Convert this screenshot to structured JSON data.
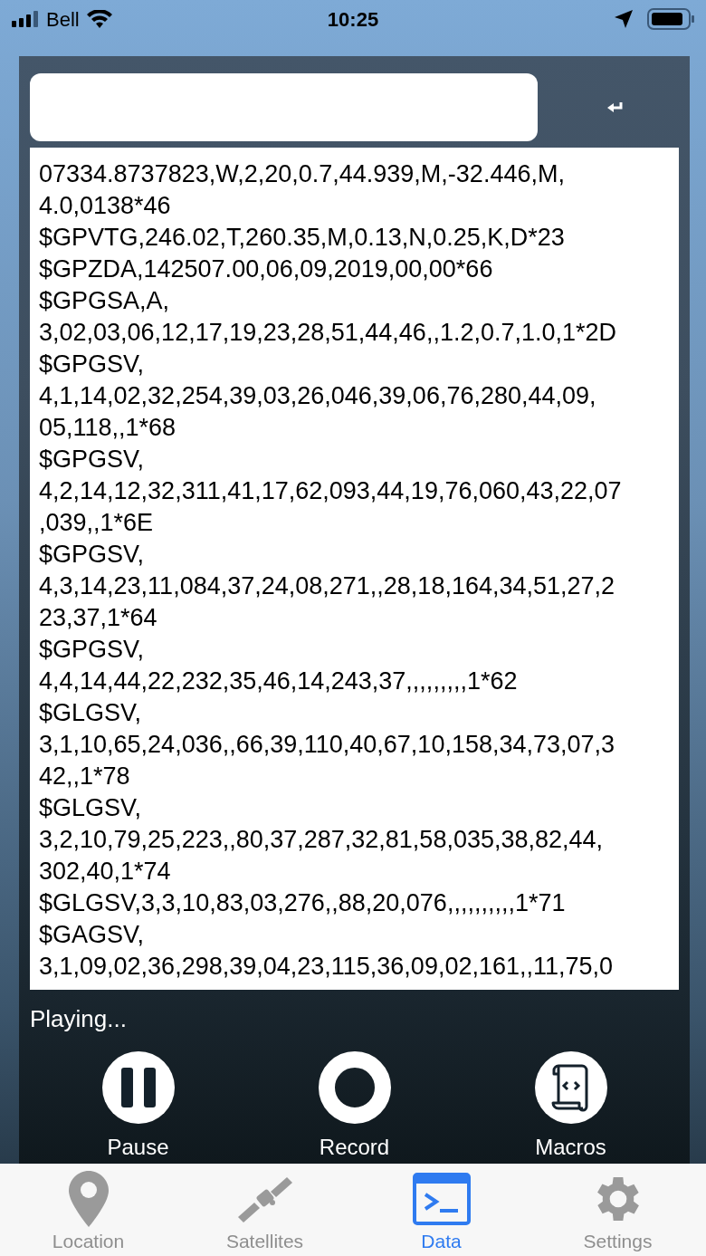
{
  "status_bar": {
    "carrier": "Bell",
    "time": "10:25"
  },
  "log_lines": [
    "07334.8737823,W,2,20,0.7,44.939,M,-32.446,M,",
    "4.0,0138*46",
    "$GPVTG,246.02,T,260.35,M,0.13,N,0.25,K,D*23",
    "$GPZDA,142507.00,06,09,2019,00,00*66",
    "$GPGSA,A,",
    "3,02,03,06,12,17,19,23,28,51,44,46,,1.2,0.7,1.0,1*2D",
    "$GPGSV,",
    "4,1,14,02,32,254,39,03,26,046,39,06,76,280,44,09,",
    "05,118,,1*68",
    "$GPGSV,",
    "4,2,14,12,32,311,41,17,62,093,44,19,76,060,43,22,07",
    ",039,,1*6E",
    "$GPGSV,",
    "4,3,14,23,11,084,37,24,08,271,,28,18,164,34,51,27,2",
    "23,37,1*64",
    "$GPGSV,",
    "4,4,14,44,22,232,35,46,14,243,37,,,,,,,,,1*62",
    "$GLGSV,",
    "3,1,10,65,24,036,,66,39,110,40,67,10,158,34,73,07,3",
    "42,,1*78",
    "$GLGSV,",
    "3,2,10,79,25,223,,80,37,287,32,81,58,035,38,82,44,",
    "302,40,1*74",
    "$GLGSV,3,3,10,83,03,276,,88,20,076,,,,,,,,,,1*71",
    "$GAGSV,",
    "3,1,09,02,36,298,39,04,23,115,36,09,02,161,,11,75,0"
  ],
  "player_status": "Playing...",
  "controls": [
    {
      "kind": "pause",
      "label": "Pause"
    },
    {
      "kind": "record",
      "label": "Record"
    },
    {
      "kind": "macros",
      "label": "Macros"
    }
  ],
  "tabs": [
    {
      "kind": "location",
      "label": "Location",
      "selected": false
    },
    {
      "kind": "satellites",
      "label": "Satellites",
      "selected": false
    },
    {
      "kind": "data",
      "label": "Data",
      "selected": true
    },
    {
      "kind": "settings",
      "label": "Settings",
      "selected": false
    }
  ]
}
